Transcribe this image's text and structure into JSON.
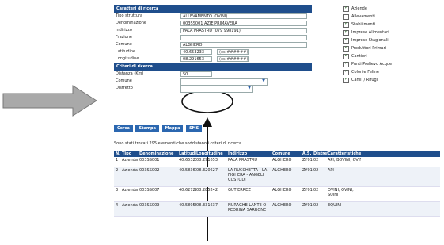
{
  "form": {
    "header_left": "Caratteri di ricerca",
    "fields": [
      {
        "label": "Tipo struttura",
        "value": "ALLEVAMENTO (OVINI)"
      },
      {
        "label": "Denominazione",
        "value": "003SS001 AZIE.PRIMAVERA"
      },
      {
        "label": "Indirizzo",
        "value": "PALA PRASTRU (079 998191)"
      },
      {
        "label": "Frazione",
        "value": ""
      },
      {
        "label": "Comune",
        "value": "ALGHERO"
      },
      {
        "label": "Latitudine",
        "value": "40.653233",
        "unit": "(es ######)"
      },
      {
        "label": "Longitudine",
        "value": "08.291653",
        "unit": "(es ######)"
      }
    ],
    "header_filter": "Criteri di ricerca",
    "filter_fields": [
      {
        "label": "Distanza (Km)",
        "value": "50"
      },
      {
        "label": "Comune",
        "value": ""
      },
      {
        "label": "Distretto",
        "value": ""
      }
    ]
  },
  "buttons": [
    "Cerca",
    "Stampa",
    "Mappa",
    "SMS"
  ],
  "result_text": "Sono stati trovati 295 elementi che soddisfano i criteri di ricerca",
  "checks": [
    {
      "label": "Aziende",
      "checked": true
    },
    {
      "label": "Allevamenti",
      "checked": false
    },
    {
      "label": "Stabilimenti",
      "checked": true
    },
    {
      "label": "Imprese Alimentari",
      "checked": true
    },
    {
      "label": "Imprese Stagionali",
      "checked": true
    },
    {
      "label": "Produttori Primari",
      "checked": true
    },
    {
      "label": "Cantieri",
      "checked": true
    },
    {
      "label": "Punti Prelievo Acque",
      "checked": true
    },
    {
      "label": "Colonie Feline",
      "checked": true
    },
    {
      "label": "Canili / Rifugi",
      "checked": true
    }
  ],
  "table": {
    "headers": [
      "N.",
      "Tipo",
      "Denominazione",
      "Latitudine",
      "Longitudine",
      "Indirizzo",
      "Comune",
      "A.S.",
      "Distretto",
      "Caratteristiche"
    ],
    "rows": [
      [
        "1",
        "Azienda",
        "003SS001",
        "40.653233",
        "08.291653",
        "PALA PRASTRU",
        "ALGHERO",
        "ZY01",
        "02",
        "API, BOVINI, OVINI"
      ],
      [
        "2",
        "Azienda",
        "003SS002",
        "40.583612",
        "08.320627",
        "LA RUCCHETTA - LA FIGHERA - ANGELI CUSTODI",
        "ALGHERO",
        "ZY01",
        "02",
        "API"
      ],
      [
        "3",
        "Azienda",
        "003SS007",
        "40.627282",
        "08.285242",
        "GUTIERREZ",
        "ALGHERO",
        "ZY01",
        "02",
        "OVINI, OVINI, SUINI"
      ],
      [
        "4",
        "Azienda",
        "003SS009",
        "40.589506",
        "08.331637",
        "NURAGHE LANTE O PEDRINA SARRONE",
        "ALGHERO",
        "ZY01",
        "02",
        "EQUINI"
      ]
    ]
  }
}
